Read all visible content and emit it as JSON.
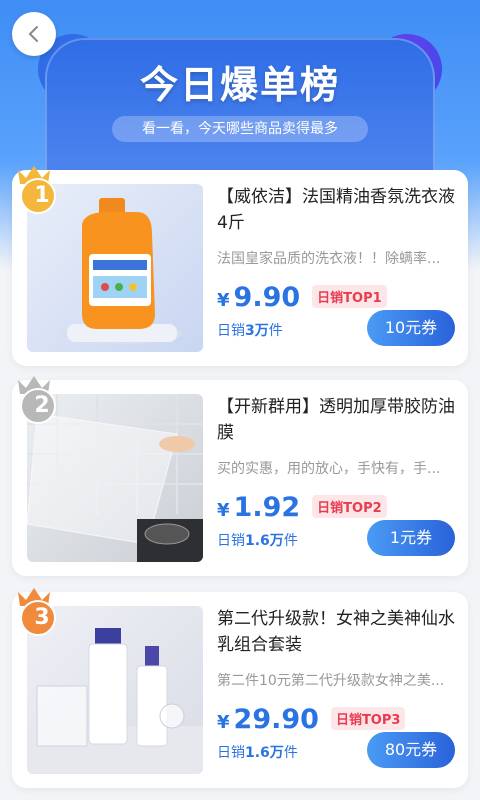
{
  "header": {
    "title": "今日爆单榜",
    "subtitle": "看一看，今天哪些商品卖得最多"
  },
  "products": [
    {
      "rank": "1",
      "title": "【威依洁】法国精油香氛洗衣液4斤",
      "desc": "法国皇家品质的洗衣液！！除螨率...",
      "price_symbol": "¥",
      "price": "9.90",
      "badge": "日销TOP1",
      "sales_prefix": "日销",
      "sales_value": "3万",
      "sales_suffix": "件",
      "coupon": "10元券"
    },
    {
      "rank": "2",
      "title": "【开新群用】透明加厚带胶防油膜",
      "desc": "买的实惠，用的放心，手快有，手...",
      "price_symbol": "¥",
      "price": "1.92",
      "badge": "日销TOP2",
      "sales_prefix": "日销",
      "sales_value": "1.6万",
      "sales_suffix": "件",
      "coupon": "1元券"
    },
    {
      "rank": "3",
      "title": "第二代升级款！女神之美神仙水乳组合套装",
      "desc": "第二件10元第二代升级款女神之美...",
      "price_symbol": "¥",
      "price": "29.90",
      "badge": "日销TOP3",
      "sales_prefix": "日销",
      "sales_value": "1.6万",
      "sales_suffix": "件",
      "coupon": "80元券"
    }
  ],
  "colors": {
    "accent": "#2a73e3",
    "badge_red": "#e83b4f",
    "gold": "#f5b73b",
    "silver": "#b8b8b8",
    "bronze": "#f08a3c"
  },
  "icons": {
    "back": "chevron-left-icon"
  }
}
